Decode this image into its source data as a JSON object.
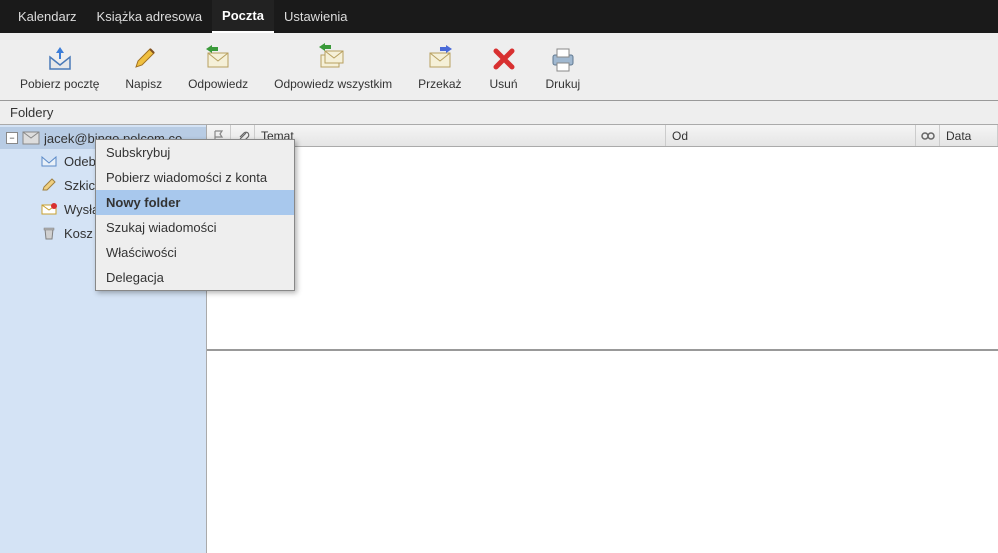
{
  "topnav": {
    "calendar": "Kalendarz",
    "addressbook": "Książka adresowa",
    "mail": "Poczta",
    "settings": "Ustawienia"
  },
  "toolbar": {
    "getmail": "Pobierz pocztę",
    "compose": "Napisz",
    "reply": "Odpowiedz",
    "replyall": "Odpowiedz wszystkim",
    "forward": "Przekaż",
    "delete": "Usuń",
    "print": "Drukuj"
  },
  "sidebar": {
    "header": "Foldery",
    "account": "jacek@bingo.polcom.co",
    "folders": {
      "inbox": "Odebrane",
      "drafts": "Szkice",
      "sent": "Wysłane",
      "trash": "Kosz"
    }
  },
  "columns": {
    "subject": "Temat",
    "from": "Od",
    "date": "Data"
  },
  "contextmenu": {
    "subscribe": "Subskrybuj",
    "getaccount": "Pobierz wiadomości z konta",
    "newfolder": "Nowy folder",
    "search": "Szukaj wiadomości",
    "props": "Właściwości",
    "delegation": "Delegacja"
  }
}
